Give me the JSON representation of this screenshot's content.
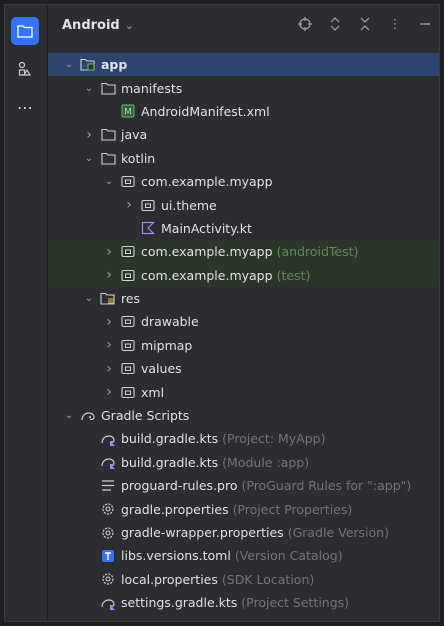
{
  "header": {
    "title": "Android"
  },
  "tree": [
    {
      "label": "app",
      "bold": true,
      "depth": 0,
      "arrow": "down",
      "icon": "module-folder-icon",
      "selected": true
    },
    {
      "label": "manifests",
      "depth": 1,
      "arrow": "down",
      "icon": "folder-icon"
    },
    {
      "label": "AndroidManifest.xml",
      "depth": 2,
      "arrow": "",
      "icon": "manifest-file-icon"
    },
    {
      "label": "java",
      "depth": 1,
      "arrow": "right",
      "icon": "folder-icon"
    },
    {
      "label": "kotlin",
      "depth": 1,
      "arrow": "down",
      "icon": "folder-icon"
    },
    {
      "label": "com.example.myapp",
      "depth": 2,
      "arrow": "down",
      "icon": "package-icon"
    },
    {
      "label": "ui.theme",
      "depth": 3,
      "arrow": "right",
      "icon": "package-icon"
    },
    {
      "label": "MainActivity.kt",
      "depth": 3,
      "arrow": "",
      "icon": "kotlin-file-icon"
    },
    {
      "label": "com.example.myapp",
      "extra": "(androidTest)",
      "extraGreen": true,
      "depth": 2,
      "arrow": "right",
      "icon": "package-icon",
      "test": true
    },
    {
      "label": "com.example.myapp",
      "extra": "(test)",
      "extraGreen": true,
      "depth": 2,
      "arrow": "right",
      "icon": "package-icon",
      "test": true
    },
    {
      "label": "res",
      "depth": 1,
      "arrow": "down",
      "icon": "res-folder-icon"
    },
    {
      "label": "drawable",
      "depth": 2,
      "arrow": "right",
      "icon": "package-icon"
    },
    {
      "label": "mipmap",
      "depth": 2,
      "arrow": "right",
      "icon": "package-icon"
    },
    {
      "label": "values",
      "depth": 2,
      "arrow": "right",
      "icon": "package-icon"
    },
    {
      "label": "xml",
      "depth": 2,
      "arrow": "right",
      "icon": "package-icon"
    },
    {
      "label": "Gradle Scripts",
      "depth": 0,
      "arrow": "down",
      "icon": "gradle-icon"
    },
    {
      "label": "build.gradle.kts",
      "extra": "(Project: MyApp)",
      "depth": 1,
      "arrow": "",
      "icon": "gradle-kts-icon"
    },
    {
      "label": "build.gradle.kts",
      "extra": "(Module :app)",
      "depth": 1,
      "arrow": "",
      "icon": "gradle-kts-icon"
    },
    {
      "label": "proguard-rules.pro",
      "extra": "(ProGuard Rules for \":app\")",
      "depth": 1,
      "arrow": "",
      "icon": "text-file-icon"
    },
    {
      "label": "gradle.properties",
      "extra": "(Project Properties)",
      "depth": 1,
      "arrow": "",
      "icon": "settings-icon"
    },
    {
      "label": "gradle-wrapper.properties",
      "extra": "(Gradle Version)",
      "depth": 1,
      "arrow": "",
      "icon": "settings-icon"
    },
    {
      "label": "libs.versions.toml",
      "extra": "(Version Catalog)",
      "depth": 1,
      "arrow": "",
      "icon": "toml-icon"
    },
    {
      "label": "local.properties",
      "extra": "(SDK Location)",
      "depth": 1,
      "arrow": "",
      "icon": "settings-icon"
    },
    {
      "label": "settings.gradle.kts",
      "extra": "(Project Settings)",
      "depth": 1,
      "arrow": "",
      "icon": "gradle-kts-icon"
    }
  ]
}
